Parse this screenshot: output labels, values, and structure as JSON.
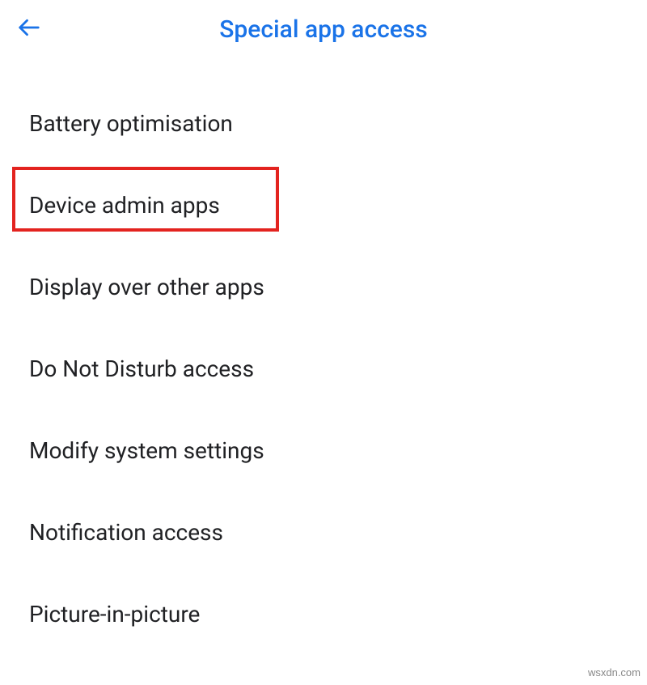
{
  "header": {
    "title": "Special app access"
  },
  "list": {
    "items": [
      {
        "label": "Battery optimisation"
      },
      {
        "label": "Device admin apps"
      },
      {
        "label": "Display over other apps"
      },
      {
        "label": "Do Not Disturb access"
      },
      {
        "label": "Modify system settings"
      },
      {
        "label": "Notification access"
      },
      {
        "label": "Picture-in-picture"
      }
    ]
  },
  "highlighted_index": 1,
  "watermark": "wsxdn.com",
  "colors": {
    "accent": "#1a73e8",
    "highlight": "#e3231f"
  }
}
